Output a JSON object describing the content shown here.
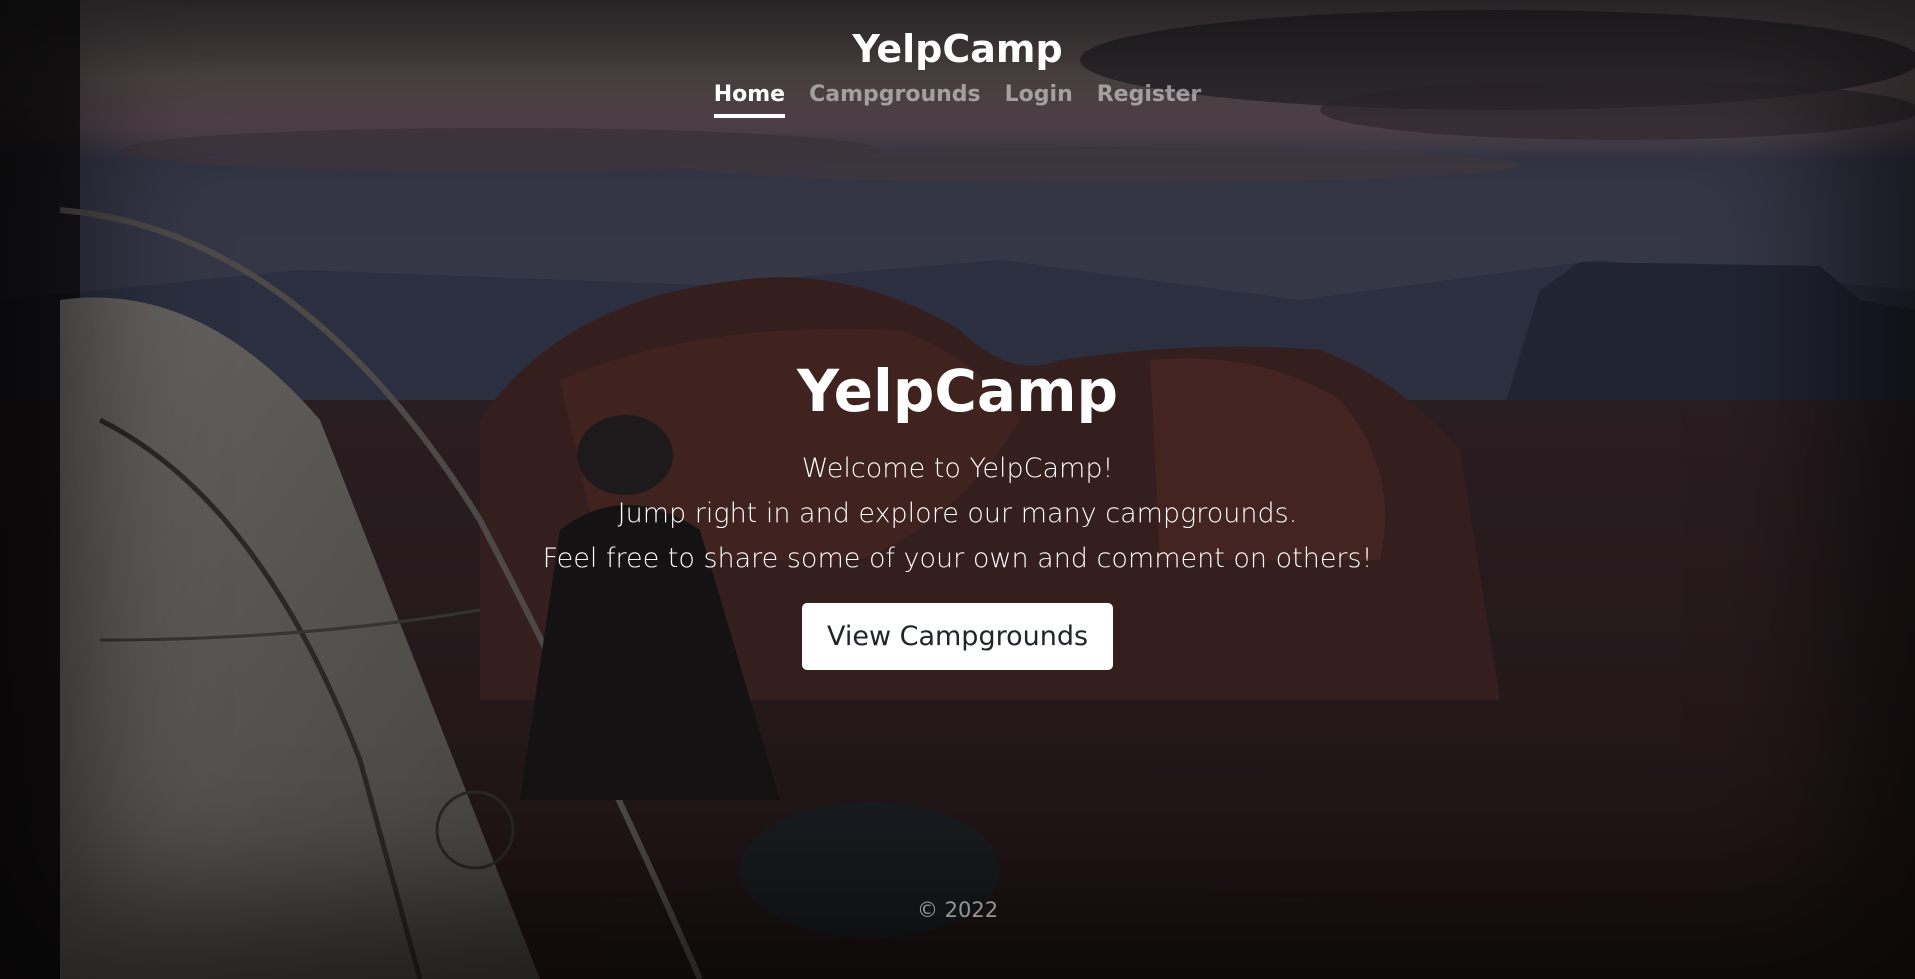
{
  "header": {
    "brand": "YelpCamp",
    "nav": [
      {
        "label": "Home",
        "active": true
      },
      {
        "label": "Campgrounds",
        "active": false
      },
      {
        "label": "Login",
        "active": false
      },
      {
        "label": "Register",
        "active": false
      }
    ]
  },
  "hero": {
    "title": "YelpCamp",
    "lines": [
      "Welcome to YelpCamp!",
      "Jump right in and explore our many campgrounds.",
      "Feel free to share some of your own and comment on others!"
    ],
    "cta_label": "View Campgrounds"
  },
  "footer": {
    "text": "© 2022"
  },
  "colors": {
    "text": "#ffffff",
    "button_bg": "#ffffff",
    "button_text": "#212529"
  }
}
